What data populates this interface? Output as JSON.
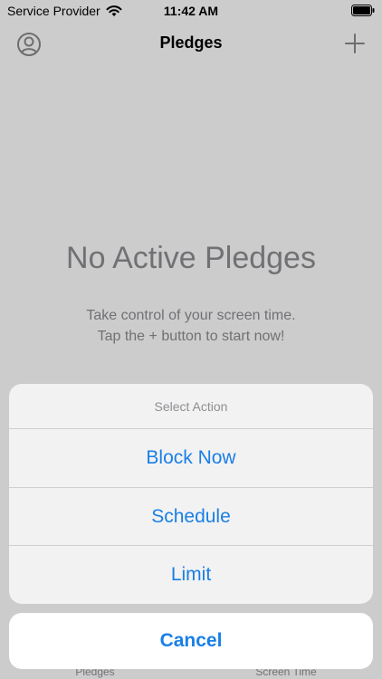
{
  "status": {
    "carrier": "Service Provider",
    "time": "11:42 AM"
  },
  "nav": {
    "title": "Pledges",
    "profile_icon": "person-circle-icon",
    "add_icon": "plus-icon"
  },
  "empty_state": {
    "title": "No Active Pledges",
    "line1": "Take control of your screen time.",
    "line2": "Tap the + button to start now!"
  },
  "tabs": [
    {
      "label": "Pledges"
    },
    {
      "label": "Screen Time"
    }
  ],
  "action_sheet": {
    "title": "Select Action",
    "options": [
      {
        "label": "Block Now"
      },
      {
        "label": "Schedule"
      },
      {
        "label": "Limit"
      }
    ],
    "cancel": "Cancel"
  },
  "colors": {
    "accent": "#1a7fe6",
    "secondary_text": "#8e8e93"
  }
}
